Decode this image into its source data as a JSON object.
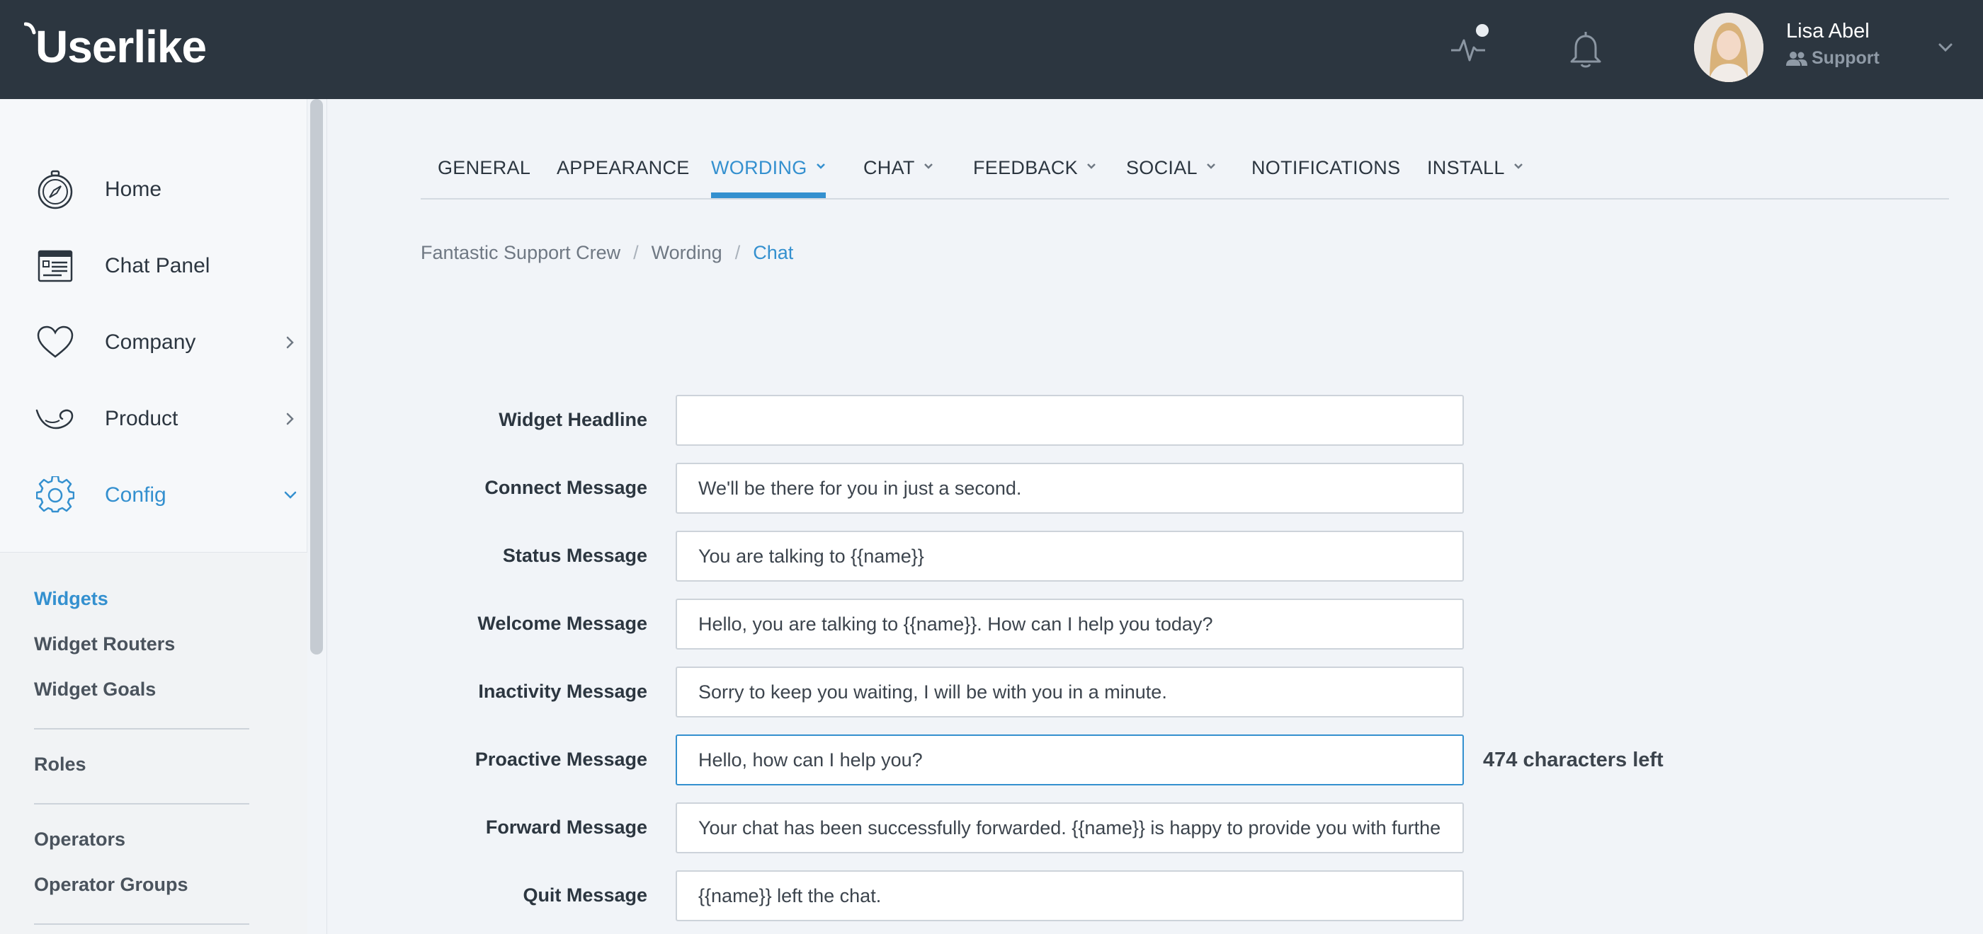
{
  "app": {
    "logo_text": "Userlike"
  },
  "header": {
    "user_name": "Lisa Abel",
    "user_role": "Support",
    "icons": [
      "activity-icon",
      "bell-icon",
      "chevron-down-icon"
    ]
  },
  "sidebar": {
    "items": [
      {
        "label": "Home",
        "icon": "compass-icon"
      },
      {
        "label": "Chat Panel",
        "icon": "chat-panel-icon"
      },
      {
        "label": "Company",
        "icon": "heart-icon",
        "arrow": "chevron-right-icon"
      },
      {
        "label": "Product",
        "icon": "product-icon",
        "arrow": "chevron-right-icon"
      },
      {
        "label": "Config",
        "icon": "gear-icon",
        "arrow": "chevron-down-icon"
      }
    ],
    "sub_items": [
      "Widgets",
      "Widget Routers",
      "Widget Goals",
      "Roles",
      "Operators",
      "Operator Groups"
    ]
  },
  "tabs": [
    {
      "label": "GENERAL"
    },
    {
      "label": "APPEARANCE"
    },
    {
      "label": "WORDING",
      "dropdown": true
    },
    {
      "label": "CHAT",
      "dropdown": true
    },
    {
      "label": "FEEDBACK",
      "dropdown": true
    },
    {
      "label": "SOCIAL",
      "dropdown": true
    },
    {
      "label": "NOTIFICATIONS"
    },
    {
      "label": "INSTALL",
      "dropdown": true
    }
  ],
  "breadcrumb": {
    "items": [
      "Fantastic Support Crew",
      "Wording",
      "Chat"
    ],
    "separator": "/"
  },
  "form": {
    "rows": [
      {
        "label": "Widget Headline",
        "value": ""
      },
      {
        "label": "Connect Message",
        "value": "We'll be there for you in just a second."
      },
      {
        "label": "Status Message",
        "value": "You are talking to {{name}}"
      },
      {
        "label": "Welcome Message",
        "value": "Hello, you are talking to {{name}}. How can I help you today?"
      },
      {
        "label": "Inactivity Message",
        "value": "Sorry to keep you waiting, I will be with you in a minute."
      },
      {
        "label": "Proactive Message",
        "value": "Hello, how can I help you?",
        "hint": "474 characters left"
      },
      {
        "label": "Forward Message",
        "value": "Your chat has been successfully forwarded. {{name}} is happy to provide you with further assistance."
      },
      {
        "label": "Quit Message",
        "value": "{{name}} left the chat."
      }
    ]
  },
  "colors": {
    "topbar": "#2c3640",
    "accent": "#3490cf",
    "background": "#f1f4f8"
  }
}
